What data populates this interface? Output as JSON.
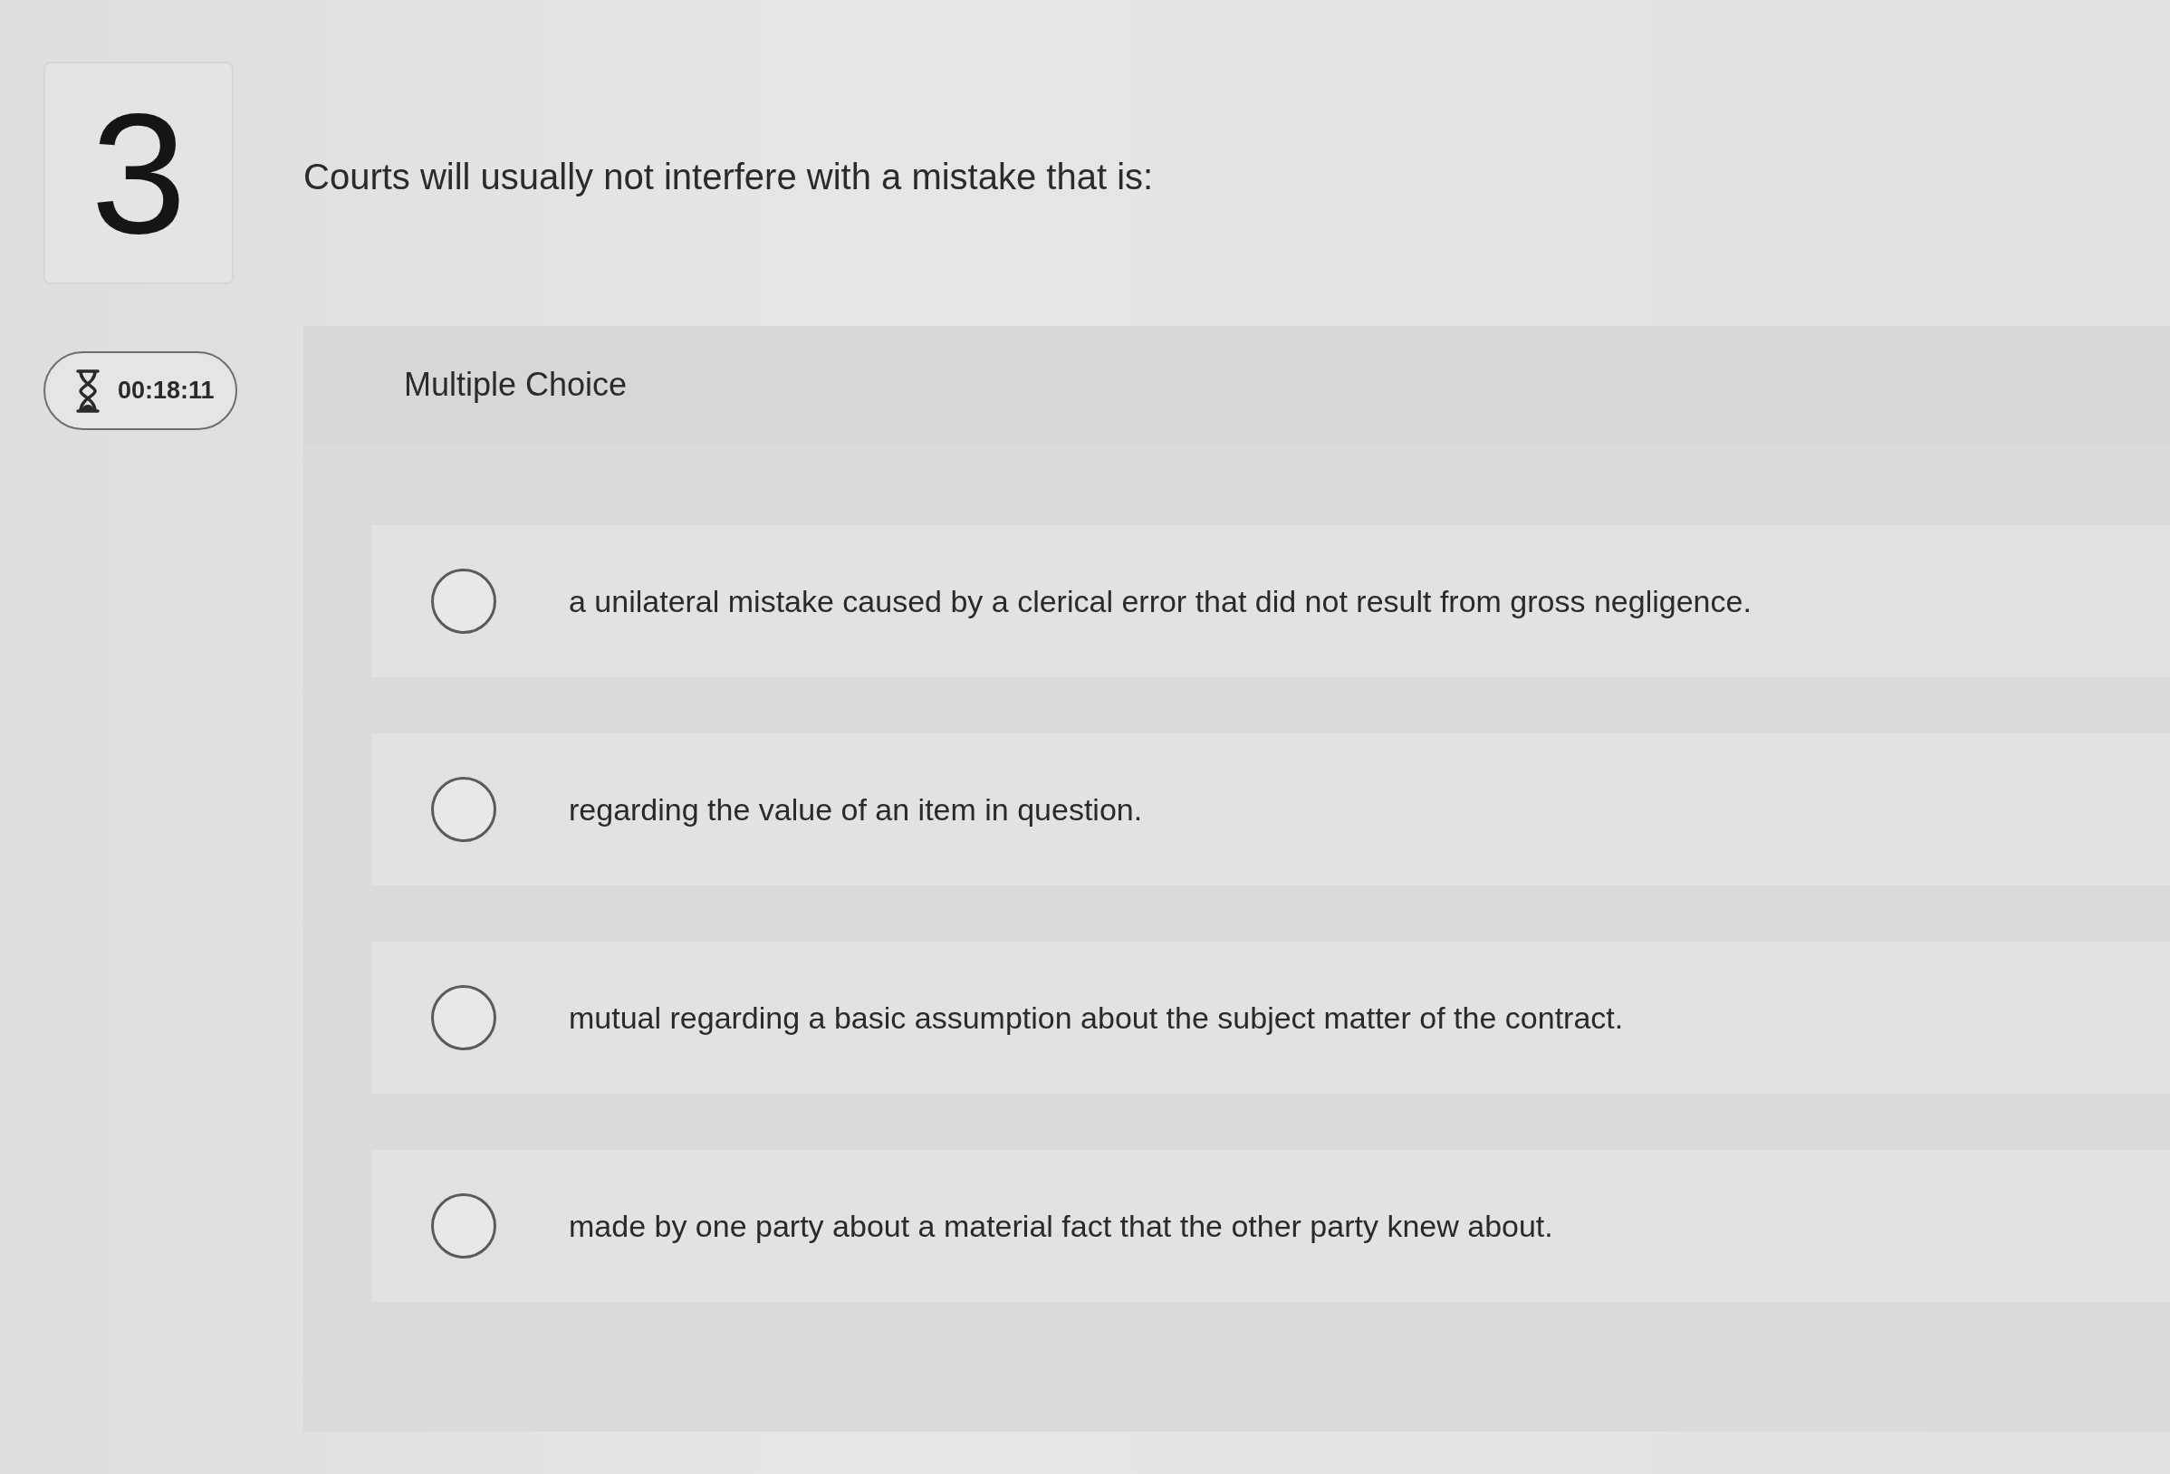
{
  "question": {
    "number": "3",
    "text": "Courts will usually not interfere with a mistake that is:"
  },
  "timer": {
    "time": "00:18:11"
  },
  "answer_panel": {
    "type_label": "Multiple Choice",
    "options": [
      {
        "text": "a unilateral mistake caused by a clerical error that did not result from gross negligence.",
        "selected": false
      },
      {
        "text": "regarding the value of an item in question.",
        "selected": false
      },
      {
        "text": "mutual regarding a basic assumption about the subject matter of the contract.",
        "selected": false
      },
      {
        "text": "made by one party about a material fact that the other party knew about.",
        "selected": false
      }
    ]
  }
}
